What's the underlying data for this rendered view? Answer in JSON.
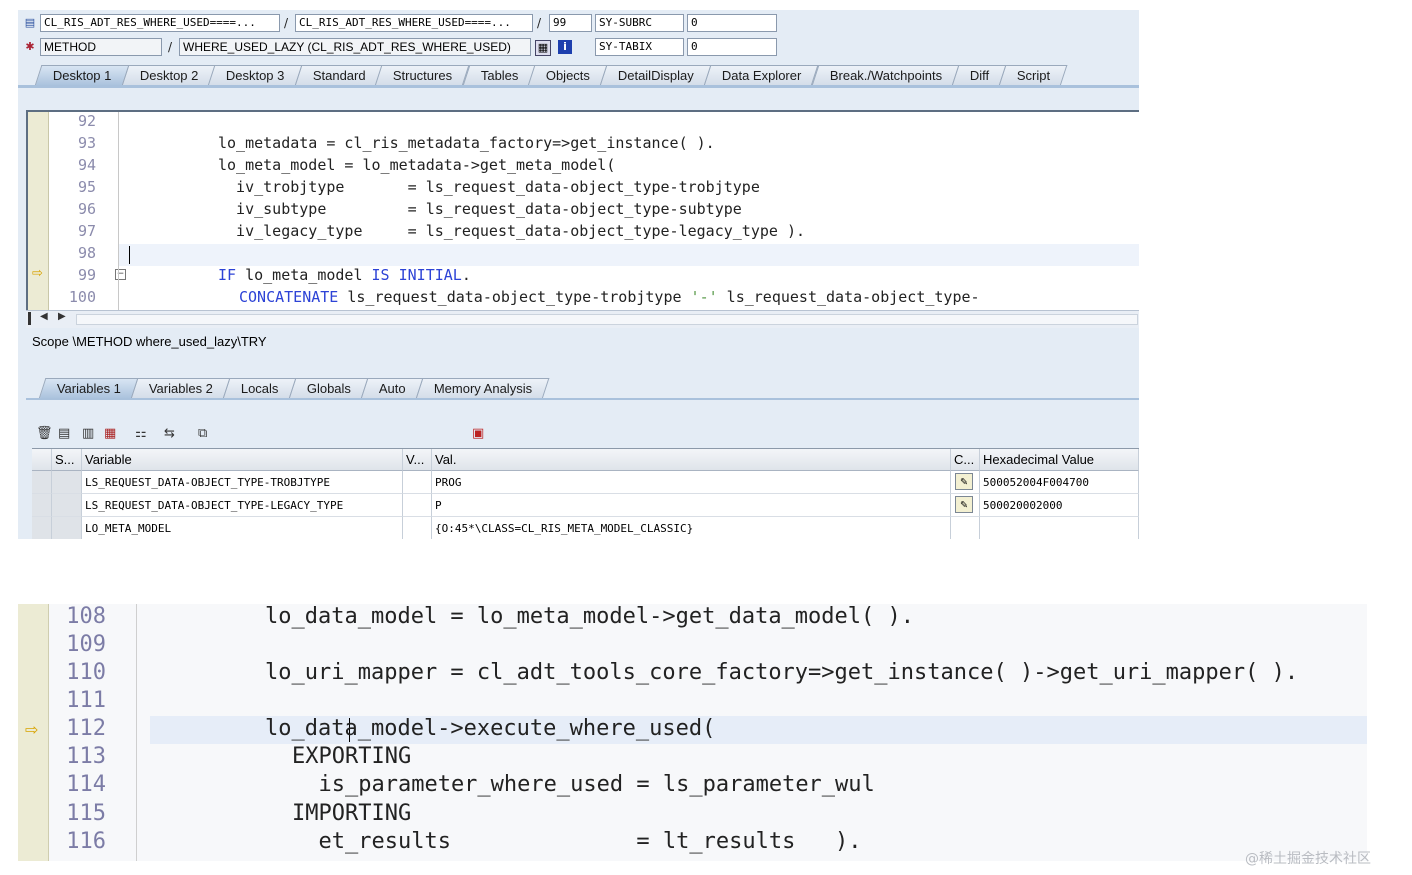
{
  "header": {
    "row1": {
      "program": "CL_RIS_ADT_RES_WHERE_USED====...",
      "include": "CL_RIS_ADT_RES_WHERE_USED====...",
      "line": "99",
      "sysvar_name": "SY-SUBRC",
      "sysvar_value": "0"
    },
    "row2": {
      "event_type": "METHOD",
      "event": "WHERE_USED_LAZY (CL_RIS_ADT_RES_WHERE_USED)",
      "sysvar_name": "SY-TABIX",
      "sysvar_value": "0"
    },
    "separator": "/"
  },
  "desktop_tabs": [
    "Desktop 1",
    "Desktop 2",
    "Desktop 3",
    "Standard",
    "Structures",
    "Tables",
    "Objects",
    "DetailDisplay",
    "Data Explorer",
    "Break./Watchpoints",
    "Diff",
    "Script"
  ],
  "code_panel": {
    "lines": [
      {
        "n": "92",
        "text": ""
      },
      {
        "n": "93",
        "text": "lo_metadata = cl_ris_metadata_factory=>get_instance( )."
      },
      {
        "n": "94",
        "text": "lo_meta_model = lo_metadata->get_meta_model("
      },
      {
        "n": "95",
        "text": "  iv_trobjtype       = ls_request_data-object_type-trobjtype"
      },
      {
        "n": "96",
        "text": "  iv_subtype         = ls_request_data-object_type-subtype"
      },
      {
        "n": "97",
        "text": "  iv_legacy_type     = ls_request_data-object_type-legacy_type )."
      },
      {
        "n": "98",
        "text": ""
      },
      {
        "n": "99",
        "kw": "IF",
        "mid": " lo_meta_model ",
        "kw2": "IS INITIAL",
        "rest": "."
      },
      {
        "n": "100",
        "kw": "CONCATENATE",
        "mid": " ls_request_data-object_type-trobjtype ",
        "str": "'-'",
        "rest": " ls_request_data-object_type-"
      }
    ]
  },
  "scope": "Scope \\METHOD where_used_lazy\\TRY",
  "variable_tabs": [
    "Variables 1",
    "Variables 2",
    "Locals",
    "Globals",
    "Auto",
    "Memory Analysis"
  ],
  "var_table": {
    "headers": [
      "S...",
      "Variable",
      "V...",
      "Val.",
      "C...",
      "Hexadecimal Value"
    ],
    "rows": [
      {
        "variable": "LS_REQUEST_DATA-OBJECT_TYPE-TROBJTYPE",
        "value": "PROG",
        "hex": "500052004F004700"
      },
      {
        "variable": "LS_REQUEST_DATA-OBJECT_TYPE-LEGACY_TYPE",
        "value": "P",
        "hex": "500020002000"
      },
      {
        "variable": "LO_META_MODEL",
        "value": "{O:45*\\CLASS=CL_RIS_META_MODEL_CLASSIC}",
        "hex": ""
      }
    ]
  },
  "zoom_panel": {
    "lines": [
      {
        "n": "108",
        "text": "lo_data_model = lo_meta_model->get_data_model( )."
      },
      {
        "n": "109",
        "text": ""
      },
      {
        "n": "110",
        "text": "lo_uri_mapper = cl_adt_tools_core_factory=>get_instance( )->get_uri_mapper( )."
      },
      {
        "n": "111",
        "text": ""
      },
      {
        "n": "112",
        "text": "lo_data_model->execute_where_used("
      },
      {
        "n": "113",
        "kw": "EXPORTING"
      },
      {
        "n": "114",
        "text": "  is_parameter_where_used = ls_parameter_wul"
      },
      {
        "n": "115",
        "kw": "IMPORTING"
      },
      {
        "n": "116",
        "text": "  et_results              = lt_results   )."
      }
    ]
  },
  "watermark": "@稀土掘金技术社区",
  "colors": {
    "keyword": "#2d43d6",
    "string": "#5a9b4b",
    "line_number": "#8b8bac",
    "gutter": "#ecebd4"
  }
}
